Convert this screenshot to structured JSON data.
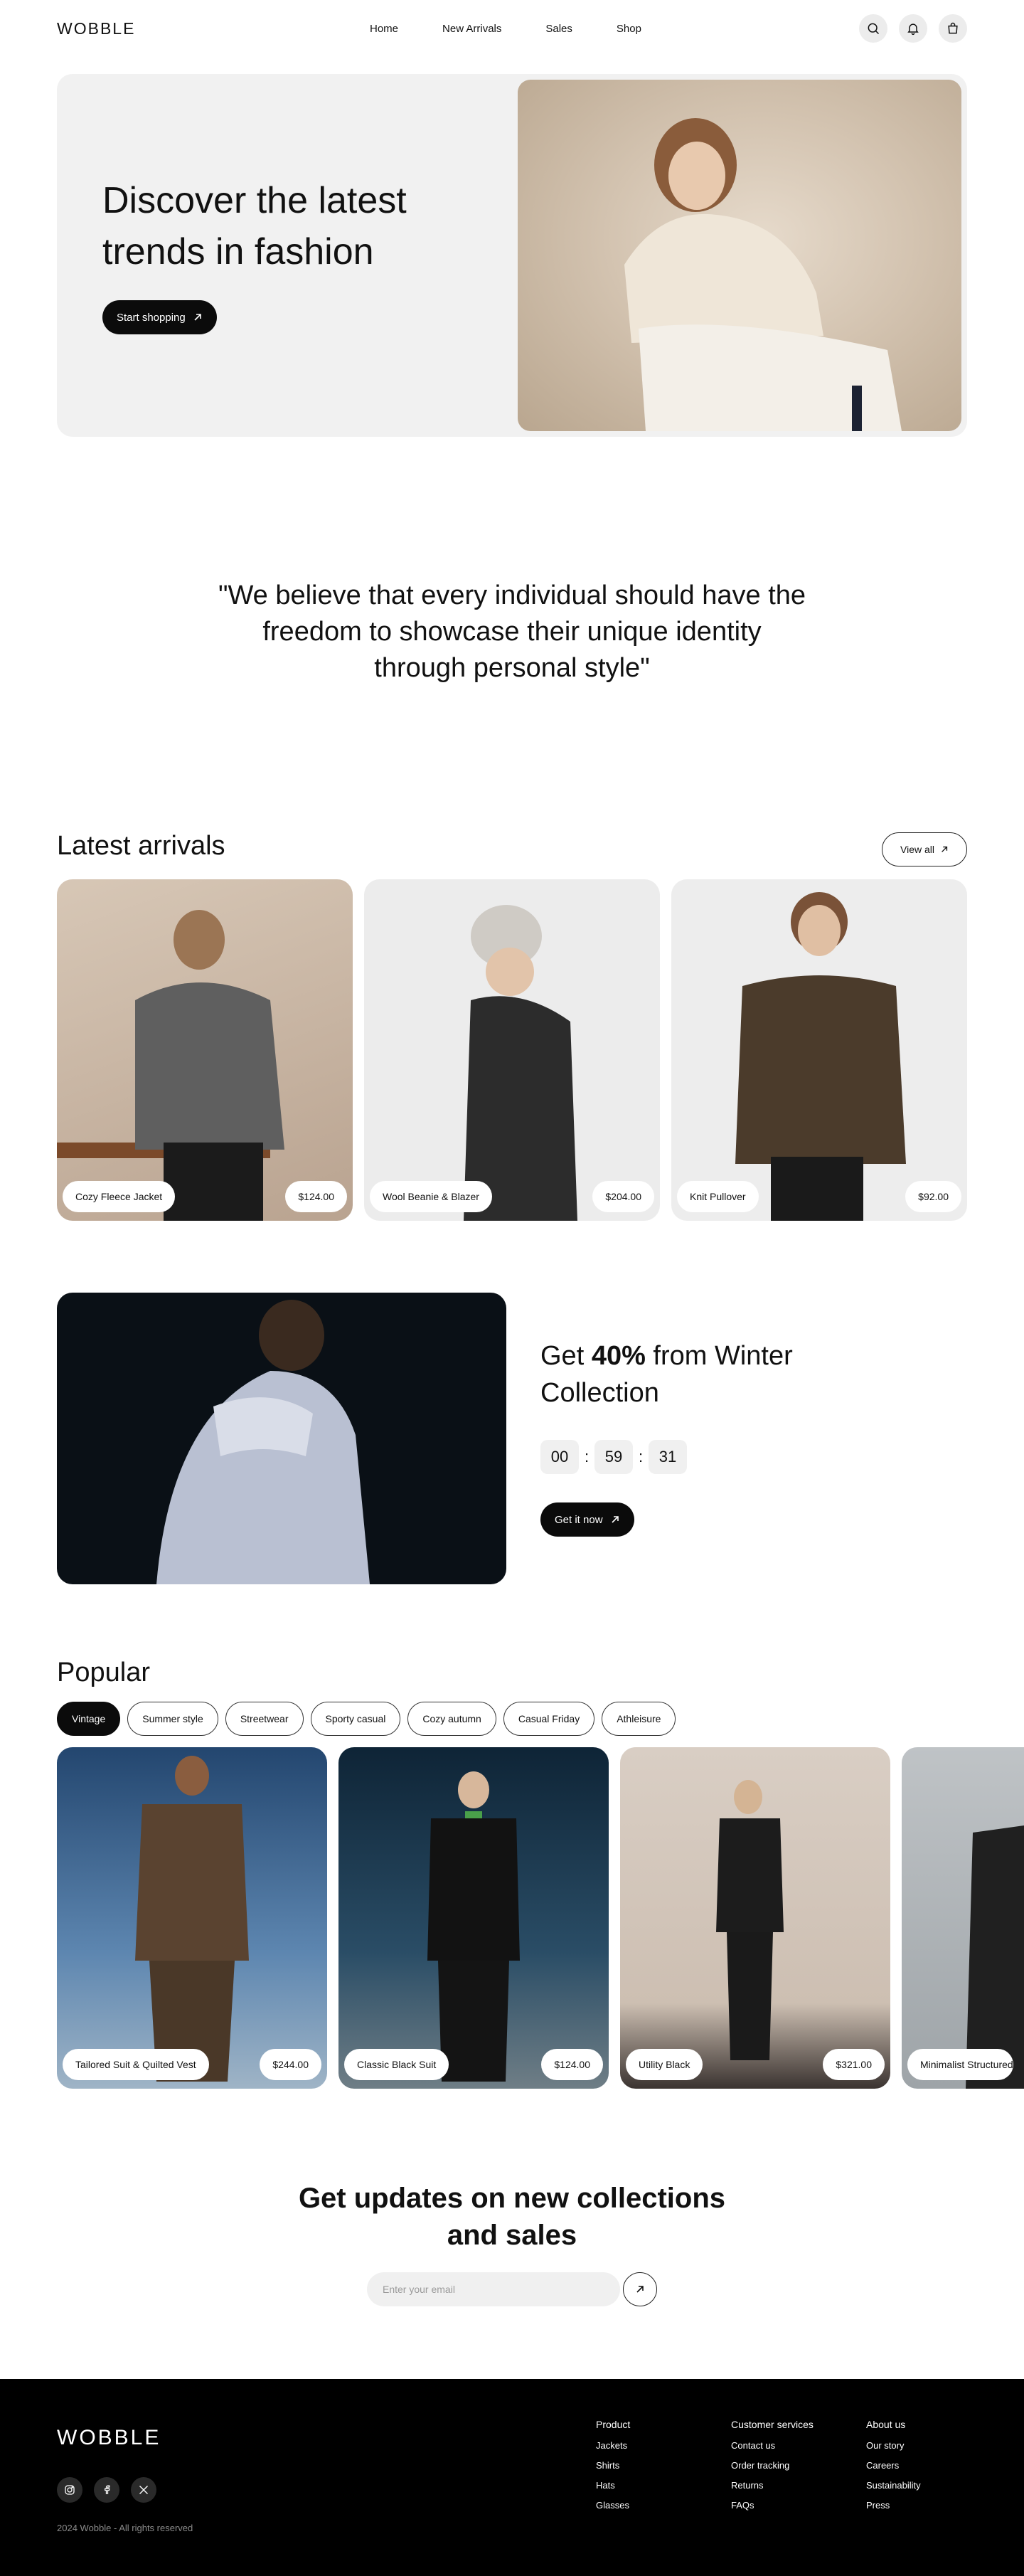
{
  "nav": {
    "logo": "WOBBLE",
    "links": [
      "Home",
      "New Arrivals",
      "Sales",
      "Shop"
    ],
    "icons": [
      "search-icon",
      "bell-icon",
      "bag-icon"
    ]
  },
  "hero": {
    "title": "Discover the latest trends in fashion",
    "cta": "Start shopping"
  },
  "quote": "\"We believe that every individual should have the freedom to showcase their unique identity through personal style\"",
  "latest": {
    "title": "Latest arrivals",
    "view_all": "View all",
    "items": [
      {
        "name": "Cozy Fleece Jacket",
        "price": "$124.00"
      },
      {
        "name": "Wool Beanie & Blazer",
        "price": "$204.00"
      },
      {
        "name": "Knit Pullover",
        "price": "$92.00"
      }
    ]
  },
  "promo": {
    "title_prefix": "Get ",
    "title_bold": "40%",
    "title_suffix": " from Winter Collection",
    "timer": [
      "00",
      "59",
      "31"
    ],
    "cta": "Get it now"
  },
  "popular": {
    "title": "Popular",
    "filters": [
      "Vintage",
      "Summer style",
      "Streetwear",
      "Sporty casual",
      "Cozy autumn",
      "Casual Friday",
      "Athleisure"
    ],
    "active_filter": "Vintage",
    "items": [
      {
        "name": "Tailored Suit & Quilted Vest",
        "price": "$244.00"
      },
      {
        "name": "Classic Black Suit",
        "price": "$124.00"
      },
      {
        "name": "Utility Black",
        "price": "$321.00"
      },
      {
        "name": "Minimalist Structured",
        "price": ""
      }
    ]
  },
  "newsletter": {
    "title": "Get updates on new collections and sales",
    "placeholder": "Enter your email"
  },
  "footer": {
    "logo": "WOBBLE",
    "socials": [
      "instagram-icon",
      "facebook-icon",
      "x-icon"
    ],
    "copyright": "2024 Wobble - All rights reserved",
    "columns": [
      {
        "title": "Product",
        "links": [
          "Jackets",
          "Shirts",
          "Hats",
          "Glasses"
        ]
      },
      {
        "title": "Customer services",
        "links": [
          "Contact us",
          "Order tracking",
          "Returns",
          "FAQs"
        ]
      },
      {
        "title": "About us",
        "links": [
          "Our story",
          "Careers",
          "Sustainability",
          "Press"
        ]
      }
    ]
  },
  "colors": {
    "accent": "#0b0b0b",
    "surface": "#f1f1f1",
    "footer_bg": "#000000"
  }
}
